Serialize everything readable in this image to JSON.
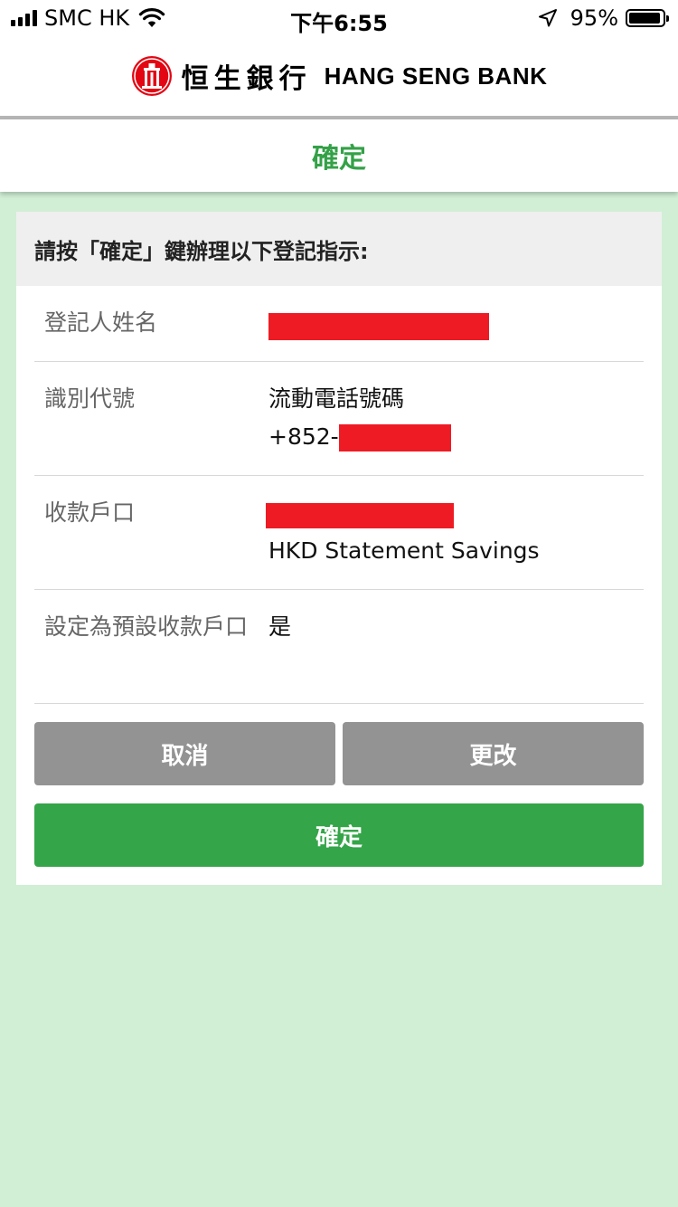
{
  "status_bar": {
    "carrier": "SMC HK",
    "time": "下午6:55",
    "battery_percent": "95%",
    "battery_level": 0.95,
    "signal_strength": 4
  },
  "brand": {
    "chinese_name": "恒生銀行",
    "english_name": "HANG SENG BANK",
    "logo_color": "#e30613"
  },
  "page": {
    "title": "確定",
    "title_color": "#34a148"
  },
  "card": {
    "instruction": "請按「確定」鍵辦理以下登記指示:",
    "rows": [
      {
        "label": "登記人姓名",
        "value_lines": []
      },
      {
        "label": "識別代號",
        "value_lines": [
          "流動電話號碼",
          "+852-"
        ]
      },
      {
        "label": "收款戶口",
        "value_lines": [
          "HKD Statement Savings"
        ]
      },
      {
        "label": "設定為預設收款戶口",
        "value_lines": [
          "是"
        ]
      }
    ],
    "redaction_color": "#ee1b24"
  },
  "buttons": {
    "cancel": "取消",
    "change": "更改",
    "confirm": "確定"
  },
  "colors": {
    "background": "#d1efd5",
    "primary_green": "#34a548",
    "secondary_grey": "#939393"
  }
}
